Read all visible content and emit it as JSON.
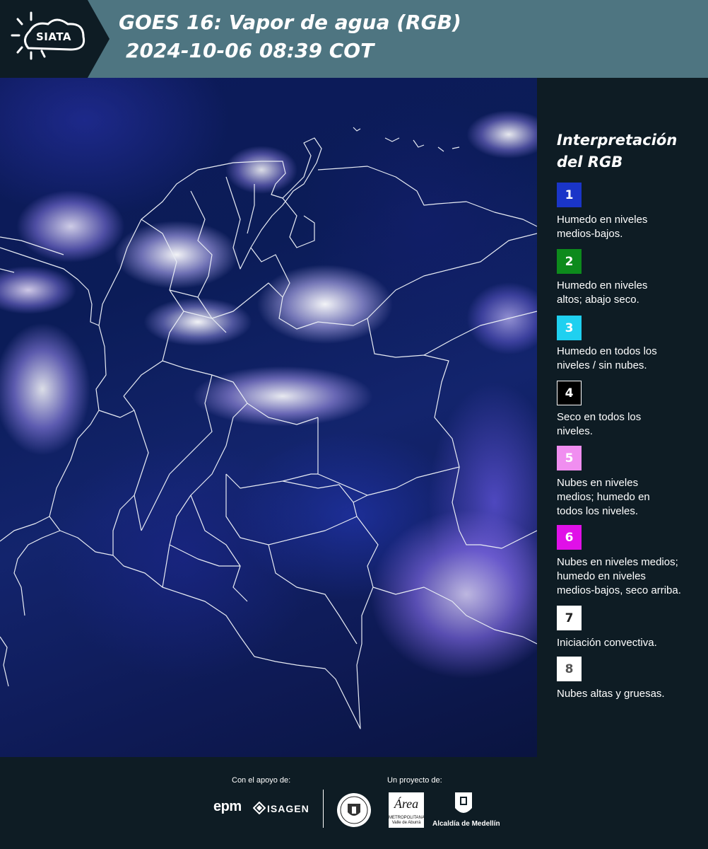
{
  "header": {
    "logo_text": "SIATA",
    "title": "GOES 16: Vapor de agua (RGB)",
    "subtitle": "2024-10-06 08:39 COT",
    "background_color": "#4e7581",
    "logo_background_color": "#0e1c24"
  },
  "legend": {
    "title_line1": "Interpretación",
    "title_line2": "del RGB",
    "items": [
      {
        "number": "1",
        "color": "#1a35c8",
        "text_color": "#ffffff",
        "line1": "Humedo en niveles",
        "line2": "medios-bajos.",
        "line3": ""
      },
      {
        "number": "2",
        "color": "#0d8a1c",
        "text_color": "#ffffff",
        "line1": "Humedo en niveles",
        "line2": "altos; abajo seco.",
        "line3": ""
      },
      {
        "number": "3",
        "color": "#1fd0f0",
        "text_color": "#ffffff",
        "line1": "Humedo en todos los",
        "line2": "niveles / sin nubes.",
        "line3": ""
      },
      {
        "number": "4",
        "color": "#000000",
        "text_color": "#ffffff",
        "line1": "Seco en todos los",
        "line2": "niveles.",
        "line3": ""
      },
      {
        "number": "5",
        "color": "#f08ef0",
        "text_color": "#ffffff",
        "line1": "Nubes en niveles",
        "line2": "medios; humedo en",
        "line3": "todos los niveles."
      },
      {
        "number": "6",
        "color": "#e010e8",
        "text_color": "#ffffff",
        "line1": "Nubes en niveles medios;",
        "line2": "humedo en niveles",
        "line3": "medios-bajos, seco arriba."
      },
      {
        "number": "7",
        "color": "#ffffff",
        "text_color": "#222222",
        "line1": "Iniciación convectiva.",
        "line2": "",
        "line3": ""
      },
      {
        "number": "8",
        "color": "#ffffff",
        "text_color": "#555555",
        "line1": "Nubes altas y gruesas.",
        "line2": "",
        "line3": ""
      }
    ]
  },
  "footer": {
    "support_label": "Con el apoyo de:",
    "project_label": "Un proyecto de:",
    "logo_epm": "epm",
    "logo_isagen": "ISAGEN",
    "metro_mark": "Área",
    "metro_line1": "METROPOLITANA",
    "metro_line2": "Valle de Aburrá",
    "alcaldia": "Alcaldía de Medellín"
  }
}
